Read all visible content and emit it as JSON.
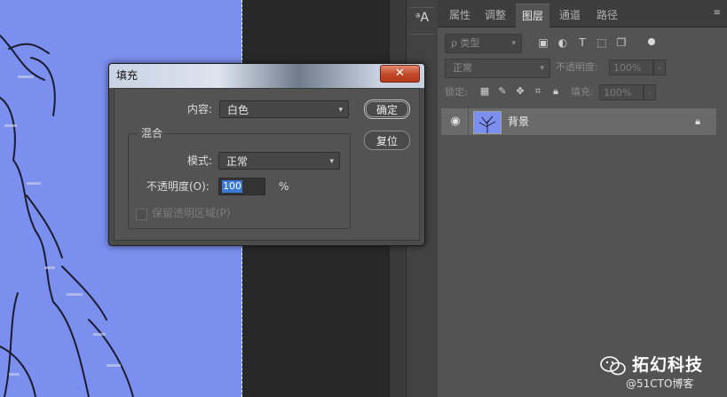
{
  "dialog": {
    "title": "填充",
    "close_label": "✕",
    "content_label": "内容:",
    "content_value": "白色",
    "ok_label": "确定",
    "reset_label": "复位",
    "blend_group_label": "混合",
    "mode_label": "模式:",
    "mode_value": "正常",
    "opacity_label": "不透明度(O):",
    "opacity_value": "100",
    "opacity_unit": "%",
    "preserve_transparency_label": "保留透明区域(P)"
  },
  "layers_panel": {
    "tabs": [
      "属性",
      "调整",
      "图层",
      "通道",
      "路径"
    ],
    "active_tab": "图层",
    "filter_label": "ρ 类型",
    "blend_mode": "正常",
    "opacity_label": "不透明度:",
    "opacity_value": "100%",
    "lock_label": "锁定:",
    "fill_label": "填充:",
    "fill_value": "100%",
    "layers": [
      {
        "name": "背景",
        "visible": true,
        "locked": true
      }
    ]
  },
  "watermark": {
    "brand": "拓幻科技",
    "sub": "@51CTO博客"
  },
  "colors": {
    "canvas_fill": "#7b8fef",
    "panel_bg": "#535353",
    "selection_highlight": "#3b79d6"
  }
}
